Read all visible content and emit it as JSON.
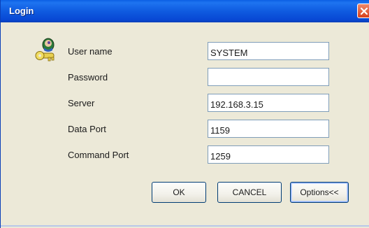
{
  "window": {
    "title": "Login"
  },
  "form": {
    "fields": [
      {
        "label": "User name",
        "value": "SYSTEM"
      },
      {
        "label": "Password",
        "value": ""
      },
      {
        "label": "Server",
        "value": "192.168.3.15"
      },
      {
        "label": "Data Port",
        "value": "1159"
      },
      {
        "label": "Command Port",
        "value": "1259"
      }
    ]
  },
  "buttons": {
    "ok": "OK",
    "cancel": "CANCEL",
    "options": "Options<<"
  },
  "icons": {
    "title_close": "close-icon",
    "login": "key-user-icon"
  },
  "colors": {
    "titlebar": "#0b5fe4",
    "dialog_bg": "#ece9d8",
    "field_border": "#7f9db9",
    "close_button": "#d8401c"
  }
}
